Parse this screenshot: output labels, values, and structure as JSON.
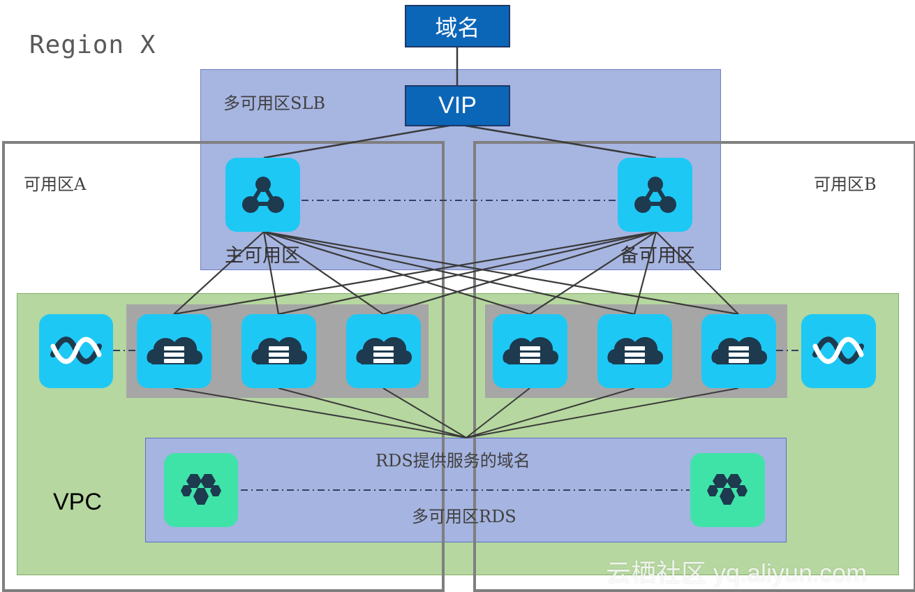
{
  "region": {
    "title": "Region X"
  },
  "dns": {
    "label": "域名"
  },
  "vip": {
    "label": "VIP"
  },
  "slb": {
    "label": "多可用区SLB",
    "primary_label": "主可用区",
    "standby_label": "备可用区"
  },
  "zones": {
    "a_label": "可用区A",
    "b_label": "可用区B"
  },
  "vpc": {
    "label": "VPC"
  },
  "rds": {
    "domain_label": "RDS提供服务的域名",
    "label": "多可用区RDS"
  },
  "watermark": {
    "text": "云栖社区 yq.aliyun.com"
  },
  "icons": {
    "slb": "load-balancer-icon",
    "ecs": "cloud-server-icon",
    "nat": "wave-gateway-icon",
    "rds": "database-cluster-icon"
  },
  "colors": {
    "vip_fill": "#0b66b8",
    "slb_panel": "#8ea0d8",
    "vpc_panel": "#a9d08e",
    "rds_panel": "#a4b2e4",
    "icon_cyan": "#1ec8f5",
    "icon_teal": "#3fe3a8",
    "icon_glyph": "#1d3a4f",
    "frame_grey": "#7f7f7f"
  }
}
